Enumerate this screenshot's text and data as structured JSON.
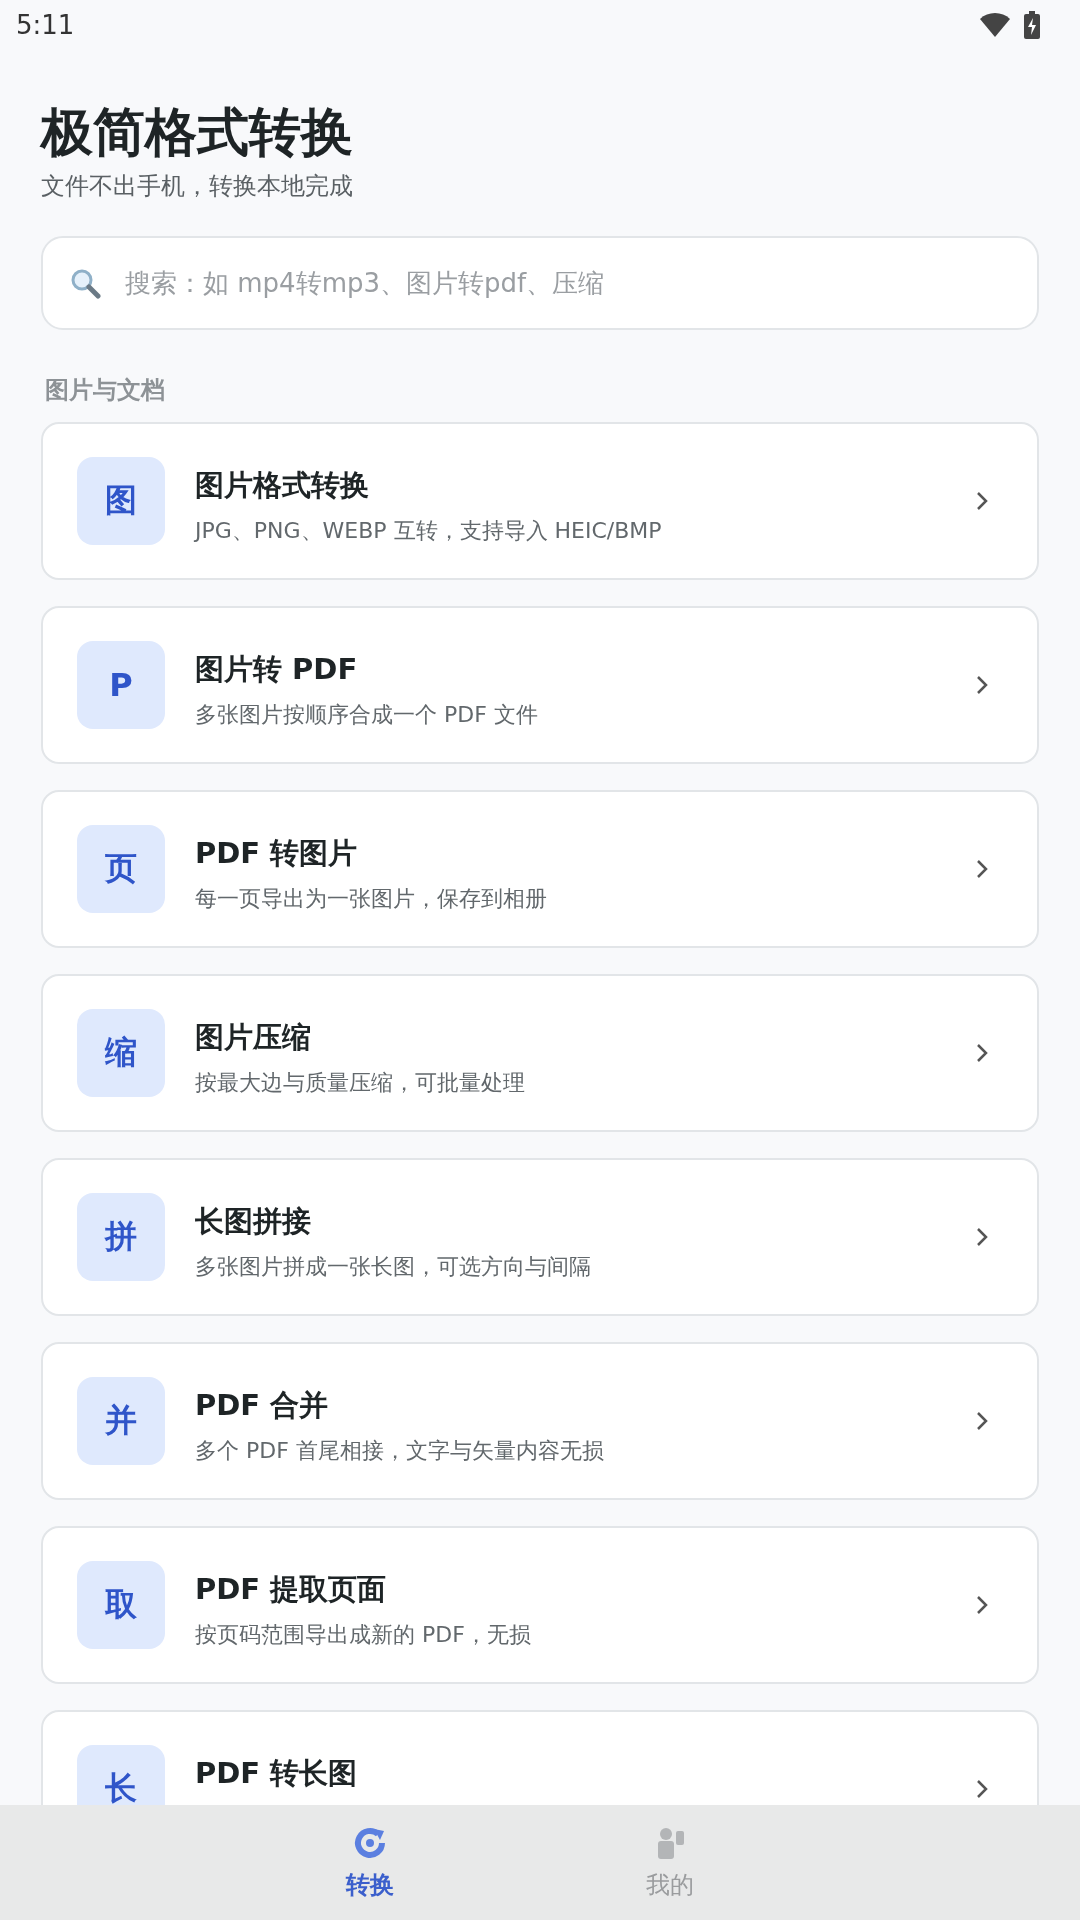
{
  "status_bar": {
    "time": "5:11"
  },
  "header": {
    "title": "极简格式转换",
    "subtitle": "文件不出手机，转换本地完成"
  },
  "search": {
    "placeholder": "搜索：如 mp4转mp3、图片转pdf、压缩"
  },
  "section": {
    "title": "图片与文档"
  },
  "tools": [
    {
      "badge": "图",
      "title": "图片格式转换",
      "description": "JPG、PNG、WEBP 互转，支持导入 HEIC/BMP"
    },
    {
      "badge": "P",
      "title": "图片转 PDF",
      "description": "多张图片按顺序合成一个 PDF 文件"
    },
    {
      "badge": "页",
      "title": "PDF 转图片",
      "description": "每一页导出为一张图片，保存到相册"
    },
    {
      "badge": "缩",
      "title": "图片压缩",
      "description": "按最大边与质量压缩，可批量处理"
    },
    {
      "badge": "拼",
      "title": "长图拼接",
      "description": "多张图片拼成一张长图，可选方向与间隔"
    },
    {
      "badge": "并",
      "title": "PDF 合并",
      "description": "多个 PDF 首尾相接，文字与矢量内容无损"
    },
    {
      "badge": "取",
      "title": "PDF 提取页面",
      "description": "按页码范围导出成新的 PDF，无损"
    },
    {
      "badge": "长",
      "title": "PDF 转长图"
    }
  ],
  "bottom_nav": [
    {
      "kind": "convert",
      "label": "转换",
      "selected": true
    },
    {
      "kind": "profile",
      "label": "我的",
      "selected": false
    }
  ]
}
